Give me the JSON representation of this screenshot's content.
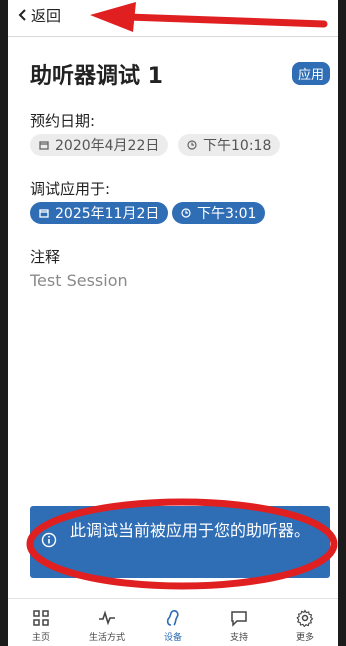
{
  "header": {
    "back_label": "返回"
  },
  "title": "助听器调试 1",
  "status_badge": "应用",
  "appointment": {
    "label": "预约日期:",
    "date": "2020年4月22日",
    "time": "下午10:18"
  },
  "applied": {
    "label": "调试应用于:",
    "date": "2025年11月2日",
    "time": "下午3:01"
  },
  "notes": {
    "label": "注释",
    "value": "Test Session"
  },
  "banner": {
    "text": "此调试当前被应用于您的助听器。"
  },
  "nav": [
    {
      "label": "主页",
      "icon": "grid-icon"
    },
    {
      "label": "生活方式",
      "icon": "activity-icon"
    },
    {
      "label": "设备",
      "icon": "hearing-aid-icon",
      "active": true
    },
    {
      "label": "支持",
      "icon": "chat-icon"
    },
    {
      "label": "更多",
      "icon": "gear-icon"
    }
  ],
  "colors": {
    "accent": "#2f6db5",
    "annotation": "#e02020",
    "chip_grey": "#ececec"
  }
}
